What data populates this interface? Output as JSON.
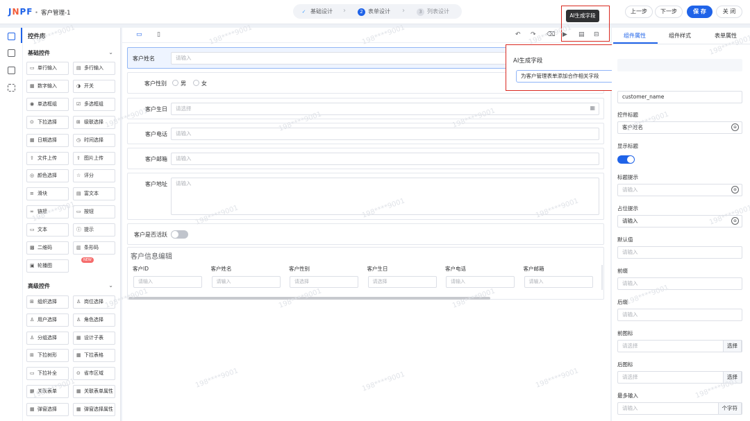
{
  "header": {
    "logo": "JNPF",
    "page_title": "客户管理-1",
    "steps": [
      {
        "num": "✓",
        "label": "基础设计"
      },
      {
        "num": "2",
        "label": "表单设计"
      },
      {
        "num": "3",
        "label": "列表设计"
      }
    ],
    "prev_label": "上一步",
    "next_label": "下一步",
    "save_label": "保 存",
    "close_label": "关 闭"
  },
  "library": {
    "title": "控件库",
    "basic_title": "基础控件",
    "basic_items": [
      {
        "icon": "▭",
        "label": "单行输入"
      },
      {
        "icon": "▤",
        "label": "多行输入"
      },
      {
        "icon": "▦",
        "label": "数字输入"
      },
      {
        "icon": "◑",
        "label": "开关"
      },
      {
        "icon": "◉",
        "label": "单选框组"
      },
      {
        "icon": "☑",
        "label": "多选框组"
      },
      {
        "icon": "⊙",
        "label": "下拉选择"
      },
      {
        "icon": "⊞",
        "label": "级联选择"
      },
      {
        "icon": "▦",
        "label": "日期选择"
      },
      {
        "icon": "◷",
        "label": "时间选择"
      },
      {
        "icon": "⇧",
        "label": "文件上传"
      },
      {
        "icon": "⇧",
        "label": "图片上传"
      },
      {
        "icon": "◎",
        "label": "颜色选择"
      },
      {
        "icon": "☆",
        "label": "评分"
      },
      {
        "icon": "≡",
        "label": "滑块"
      },
      {
        "icon": "▤",
        "label": "富文本"
      },
      {
        "icon": "∞",
        "label": "链接"
      },
      {
        "icon": "▭",
        "label": "按钮"
      },
      {
        "icon": "▭",
        "label": "文本"
      },
      {
        "icon": "ⓘ",
        "label": "提示"
      },
      {
        "icon": "▩",
        "label": "二维码"
      },
      {
        "icon": "▥",
        "label": "条形码"
      },
      {
        "icon": "▣",
        "label": "轮播图"
      }
    ],
    "new_badge": "NEW",
    "advanced_title": "高级控件",
    "advanced_items": [
      {
        "icon": "⊞",
        "label": "组织选择"
      },
      {
        "icon": "♙",
        "label": "岗位选择"
      },
      {
        "icon": "♙",
        "label": "用户选择"
      },
      {
        "icon": "♙",
        "label": "角色选择"
      },
      {
        "icon": "♙",
        "label": "分组选择"
      },
      {
        "icon": "▦",
        "label": "设计子表"
      },
      {
        "icon": "⊞",
        "label": "下拉树形"
      },
      {
        "icon": "▦",
        "label": "下拉表格"
      },
      {
        "icon": "▭",
        "label": "下拉补全"
      },
      {
        "icon": "⊙",
        "label": "省市区域"
      },
      {
        "icon": "▦",
        "label": "关联表单"
      },
      {
        "icon": "▦",
        "label": "关联表单属性"
      },
      {
        "icon": "▦",
        "label": "弹窗选择"
      },
      {
        "icon": "▦",
        "label": "弹窗选择属性"
      }
    ]
  },
  "form": {
    "name_label": "客户姓名",
    "name_placeholder": "请输入",
    "gender_label": "客户性别",
    "gender_options": [
      "男",
      "女"
    ],
    "birthday_label": "客户生日",
    "birthday_placeholder": "请选择",
    "phone_label": "客户电话",
    "phone_placeholder": "请输入",
    "email_label": "客户邮箱",
    "email_placeholder": "请输入",
    "address_label": "客户地址",
    "address_placeholder": "请输入",
    "active_label": "客户是否活跃",
    "subtable_title": "客户信息编辑",
    "subtable_headers": [
      "客户ID",
      "客户姓名",
      "客户性别",
      "客户生日",
      "客户电话",
      "客户邮箱"
    ],
    "subtable_placeholders": [
      "请输入",
      "请输入",
      "请选择",
      "请选择",
      "请输入",
      "请输入"
    ]
  },
  "ai": {
    "tooltip": "AI生成字段",
    "popup_title": "AI生成字段",
    "prompt": "为客户管理表单添加合作相关字段"
  },
  "props": {
    "tabs": [
      "组件属性",
      "组件样式",
      "表单属性"
    ],
    "field_id": "customer_name",
    "title_label": "控件标题",
    "title_value": "客户姓名",
    "show_title_label": "显示标题",
    "title_tip_label": "标题提示",
    "title_tip_placeholder": "请输入",
    "placeholder_label": "占位提示",
    "placeholder_value": "请输入",
    "default_label": "默认值",
    "default_placeholder": "请输入",
    "prefix_label": "前缀",
    "prefix_placeholder": "请输入",
    "suffix_label": "后缀",
    "suffix_placeholder": "请输入",
    "prefix_icon_label": "前图标",
    "prefix_icon_placeholder": "请选择",
    "prefix_icon_btn": "选择",
    "suffix_icon_label": "后图标",
    "suffix_icon_placeholder": "请选择",
    "suffix_icon_btn": "选择",
    "max_label": "最多输入",
    "max_placeholder": "请输入",
    "max_unit": "个字符"
  },
  "watermark": "198****9001",
  "colors": {
    "primary": "#1f63e8",
    "highlight": "#d9281f"
  }
}
